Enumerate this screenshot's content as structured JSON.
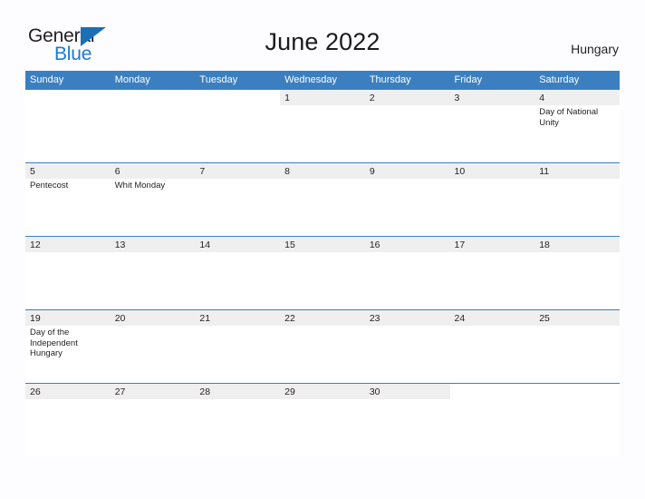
{
  "brand": {
    "name_part1": "General",
    "name_part2": "Blue",
    "triangle_color": "#1a6fb5",
    "blue_color": "#1a7ad4",
    "dark_color": "#231f20"
  },
  "header": {
    "title": "June 2022",
    "country": "Hungary"
  },
  "theme": {
    "header_blue": "#3b7fc0",
    "date_band": "#efefef",
    "page_background": "#fdfdff",
    "text_color": "#231f20"
  },
  "calendar": {
    "month": "June",
    "year": "2022",
    "weekday_headers": [
      "Sunday",
      "Monday",
      "Tuesday",
      "Wednesday",
      "Thursday",
      "Friday",
      "Saturday"
    ],
    "weeks": [
      [
        {
          "day": "",
          "event": "",
          "empty": true
        },
        {
          "day": "",
          "event": "",
          "empty": true
        },
        {
          "day": "",
          "event": "",
          "empty": true
        },
        {
          "day": "1",
          "event": ""
        },
        {
          "day": "2",
          "event": ""
        },
        {
          "day": "3",
          "event": ""
        },
        {
          "day": "4",
          "event": "Day of National Unity"
        }
      ],
      [
        {
          "day": "5",
          "event": "Pentecost"
        },
        {
          "day": "6",
          "event": "Whit Monday"
        },
        {
          "day": "7",
          "event": ""
        },
        {
          "day": "8",
          "event": ""
        },
        {
          "day": "9",
          "event": ""
        },
        {
          "day": "10",
          "event": ""
        },
        {
          "day": "11",
          "event": ""
        }
      ],
      [
        {
          "day": "12",
          "event": ""
        },
        {
          "day": "13",
          "event": ""
        },
        {
          "day": "14",
          "event": ""
        },
        {
          "day": "15",
          "event": ""
        },
        {
          "day": "16",
          "event": ""
        },
        {
          "day": "17",
          "event": ""
        },
        {
          "day": "18",
          "event": ""
        }
      ],
      [
        {
          "day": "19",
          "event": "Day of the Independent Hungary"
        },
        {
          "day": "20",
          "event": ""
        },
        {
          "day": "21",
          "event": ""
        },
        {
          "day": "22",
          "event": ""
        },
        {
          "day": "23",
          "event": ""
        },
        {
          "day": "24",
          "event": ""
        },
        {
          "day": "25",
          "event": ""
        }
      ],
      [
        {
          "day": "26",
          "event": ""
        },
        {
          "day": "27",
          "event": ""
        },
        {
          "day": "28",
          "event": ""
        },
        {
          "day": "29",
          "event": ""
        },
        {
          "day": "30",
          "event": ""
        },
        {
          "day": "",
          "event": "",
          "empty": true
        },
        {
          "day": "",
          "event": "",
          "empty": true
        }
      ]
    ]
  }
}
